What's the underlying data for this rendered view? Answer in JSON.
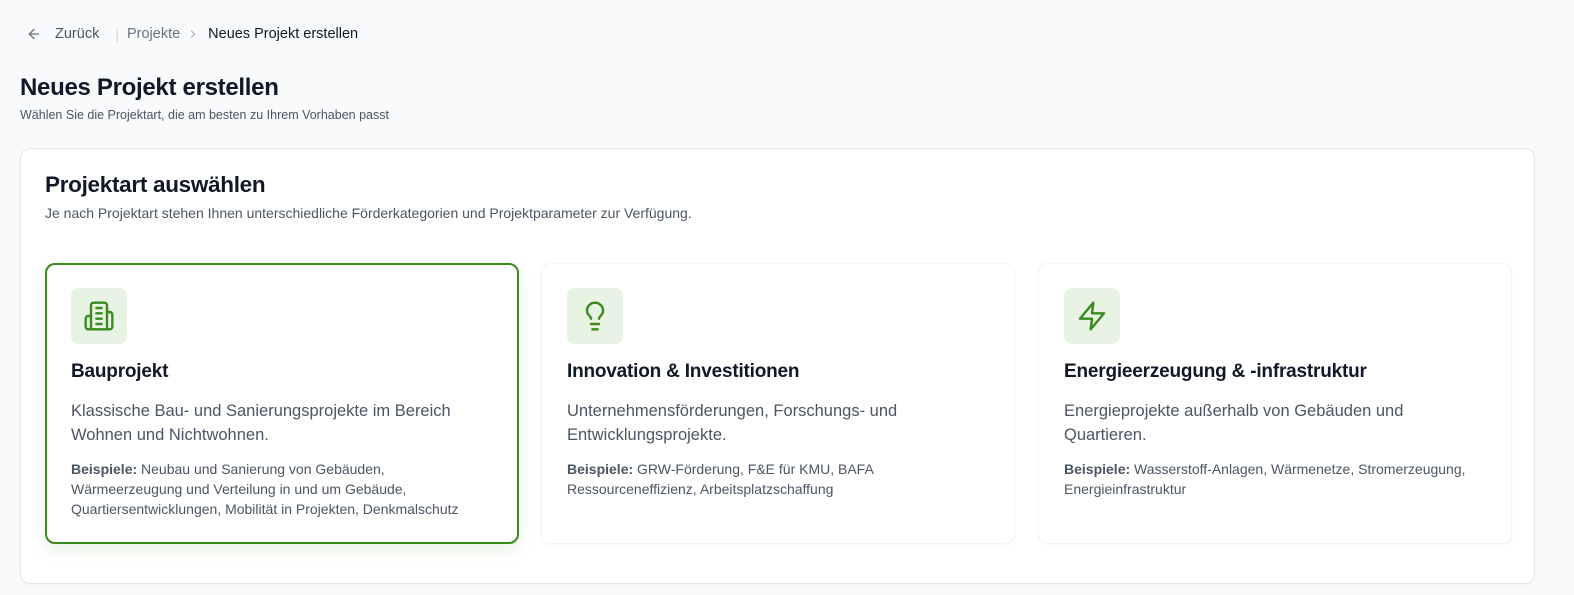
{
  "nav": {
    "back_label": "Zurück",
    "separator": "|",
    "breadcrumb_parent": "Projekte",
    "breadcrumb_current": "Neues Projekt erstellen"
  },
  "header": {
    "title": "Neues Projekt erstellen",
    "subtitle": "Wählen Sie die Projektart, die am besten zu Ihrem Vorhaben passt"
  },
  "panel": {
    "title": "Projektart auswählen",
    "description": "Je nach Projektart stehen Ihnen unterschiedliche Förderkategorien und Projektparameter zur Verfügung."
  },
  "cards": [
    {
      "icon": "building-icon",
      "title": "Bauprojekt",
      "description": "Klassische Bau- und Sanierungsprojekte im Bereich Wohnen und Nichtwohnen.",
      "examples_label": "Beispiele:",
      "examples": "Neubau und Sanierung von Gebäuden, Wärmeerzeugung und Verteilung in und um Gebäude, Quartiersentwicklungen, Mobilität in Projekten, Denkmalschutz",
      "selected": true
    },
    {
      "icon": "lightbulb-icon",
      "title": "Innovation & Investitionen",
      "description": "Unternehmensförderungen, Forschungs- und Entwicklungsprojekte.",
      "examples_label": "Beispiele:",
      "examples": "GRW-Förderung, F&E für KMU, BAFA Ressourceneffizienz, Arbeitsplatzschaffung",
      "selected": false
    },
    {
      "icon": "lightning-bolt-icon",
      "title": "Energieerzeugung & -infrastruktur",
      "description": "Energieprojekte außerhalb von Gebäuden und Quartieren.",
      "examples_label": "Beispiele:",
      "examples": "Wasserstoff-Anlagen, Wärmenetze, Stromerzeugung, Energieinfrastruktur",
      "selected": false
    }
  ],
  "colors": {
    "accent": "#3a8a1f",
    "icon_bg": "#e8f3e4"
  }
}
